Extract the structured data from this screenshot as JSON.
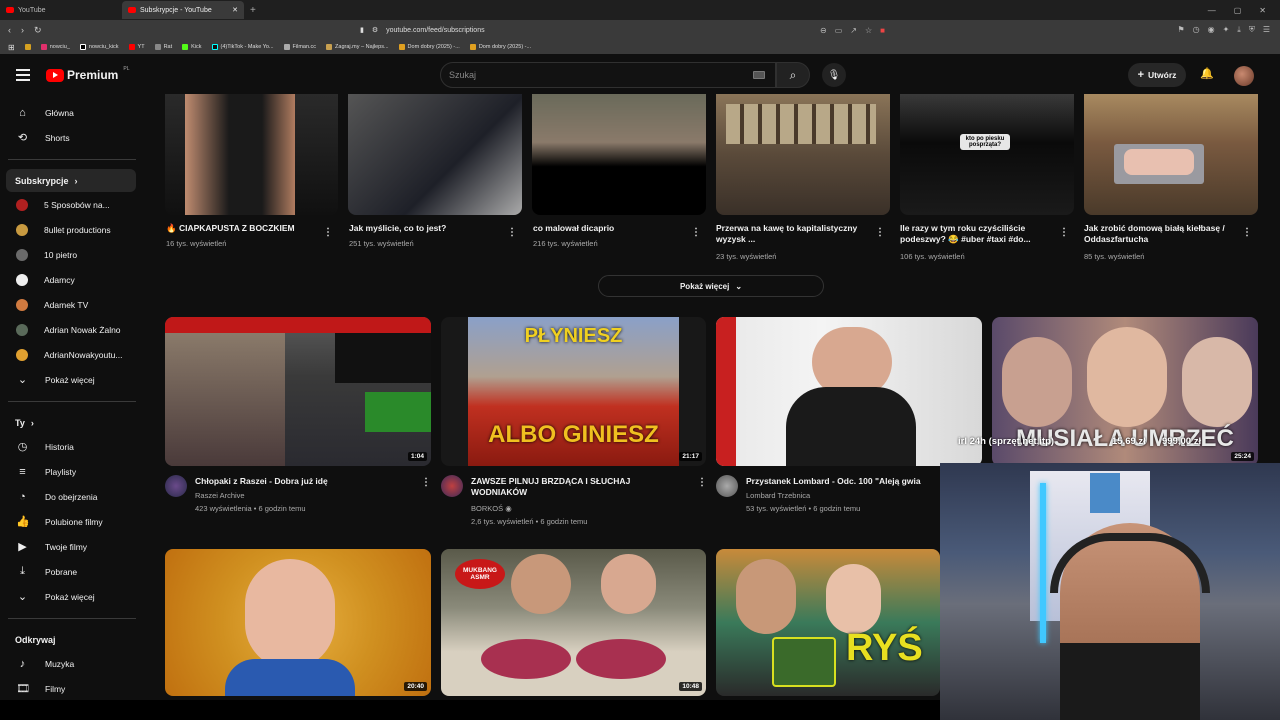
{
  "browser": {
    "tabs": [
      {
        "label": "YouTube"
      },
      {
        "label": "Subskrypcje - YouTube"
      }
    ],
    "url": "youtube.com/feed/subscriptions",
    "bookmarks": [
      "nowciu_",
      "nowciu_kick",
      "YT",
      "Rat",
      "Kick",
      "(4)TikTok - Make Yo...",
      "Filman.cc",
      "Zagraj.my – Najleps...",
      "Dom dobry (2025) -...",
      "Dom dobry (2025) -..."
    ]
  },
  "header": {
    "logo": "Premium",
    "region": "PL",
    "search_placeholder": "Szukaj",
    "create_label": "Utwórz"
  },
  "sidebar": {
    "main": [
      {
        "label": "Główna",
        "icon": "home-icon"
      },
      {
        "label": "Shorts",
        "icon": "shorts-icon"
      }
    ],
    "subs_header": "Subskrypcje",
    "subs": [
      "5 Sposobów na...",
      "8ullet productions",
      "10 pietro",
      "Adamcy",
      "Adamek TV",
      "Adrian Nowak Żalno",
      "AdrianNowakyoutu..."
    ],
    "subs_more": "Pokaż więcej",
    "you_header": "Ty",
    "you": [
      {
        "label": "Historia",
        "icon": "history-icon"
      },
      {
        "label": "Playlisty",
        "icon": "playlist-icon"
      },
      {
        "label": "Do obejrzenia",
        "icon": "clock-icon"
      },
      {
        "label": "Polubione filmy",
        "icon": "thumbs-up-icon"
      },
      {
        "label": "Twoje filmy",
        "icon": "video-icon"
      },
      {
        "label": "Pobrane",
        "icon": "download-icon"
      }
    ],
    "you_more": "Pokaż więcej",
    "explore_header": "Odkrywaj",
    "explore": [
      {
        "label": "Muzyka",
        "icon": "music-icon"
      },
      {
        "label": "Filmy",
        "icon": "film-icon"
      }
    ]
  },
  "shorts": [
    {
      "title": "🔥 CIAPKAPUSTA Z BOCZKIEM",
      "views": "16 tys. wyświetleń"
    },
    {
      "title": "Jak myślicie, co to jest?",
      "views": "251 tys. wyświetleń"
    },
    {
      "title": "co malował dicaprio",
      "views": "216 tys. wyświetleń"
    },
    {
      "title": "Przerwa na kawę to kapitalistyczny wyzysk ...",
      "views": "23 tys. wyświetleń"
    },
    {
      "title": "Ile razy w tym roku czyściliście podeszwy? 😂 #uber #taxi #do...",
      "views": "106 tys. wyświetleń",
      "overlay": "kto po piesku posprząta?"
    },
    {
      "title": "Jak zrobić domową białą kiełbasę / Oddaszfartucha",
      "views": "85 tys. wyświetleń"
    }
  ],
  "show_more": "Pokaż więcej",
  "videos": [
    {
      "title": "Chłopaki z Raszei - Dobra już idę",
      "channel": "Raszei Archive",
      "meta": "423 wyświetlenia • 6 godzin temu",
      "duration": "1:04"
    },
    {
      "title": "ZAWSZE PILNUJ BRZDĄCA I SŁUCHAJ WODNIAKÓW",
      "channel": "BORKOŚ",
      "meta": "2,6 tys. wyświetleń • 6 godzin temu",
      "duration": "21:17",
      "thumb_top": "PŁYNIESZ",
      "thumb_bottom": "ALBO GINIESZ"
    },
    {
      "title": "Przystanek Lombard - Odc. 100 \"Aleją gwia",
      "channel": "Lombard Trzebnica",
      "meta": "53 tys. wyświetleń • 6 godzin temu"
    },
    {
      "duration": "25:24",
      "thumb_text": "MUSIAŁA UMRZEĆ"
    },
    {
      "duration": "20:40"
    },
    {
      "duration": "10:48",
      "thumb_badge": "MUKBANG ASMR"
    },
    {
      "thumb_text": "RYŚ"
    }
  ],
  "overlay": {
    "text": "irl 24h (sprzęt,net,itp)",
    "num1": "15,69 zł",
    "num2": "999,00 zł"
  }
}
